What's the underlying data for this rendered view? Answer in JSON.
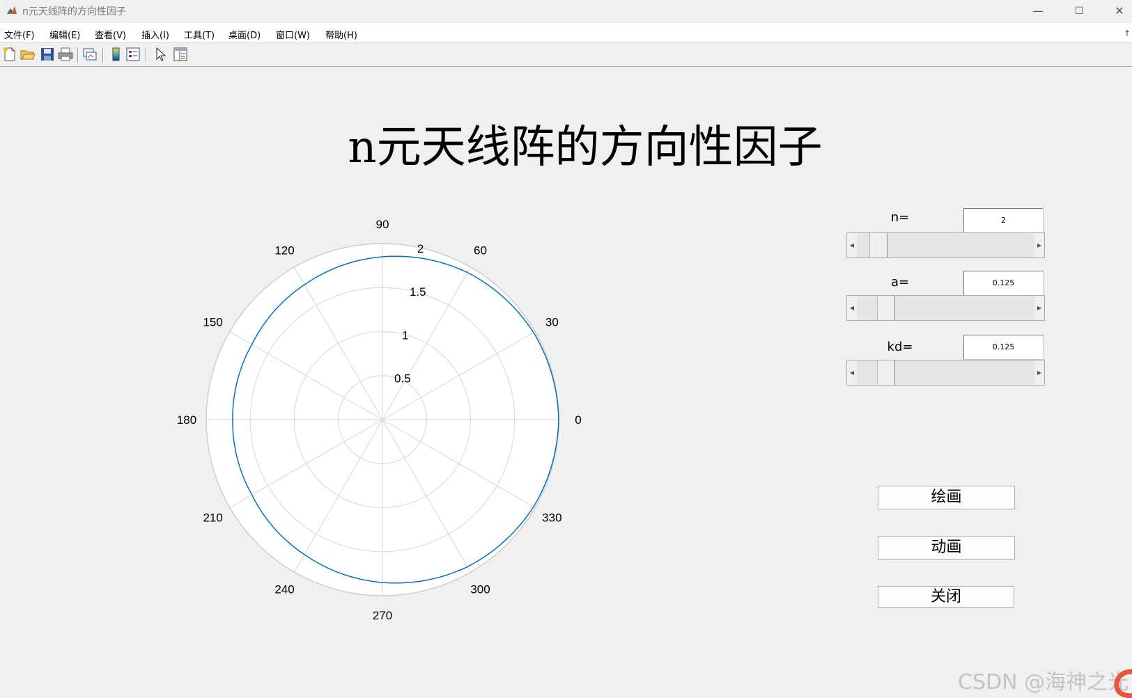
{
  "window": {
    "title": "n元天线阵的方向性因子",
    "controls": {
      "minimize": "—",
      "maximize": "☐",
      "close": "✕"
    }
  },
  "menu": {
    "items": [
      "文件(F)",
      "编辑(E)",
      "查看(V)",
      "插入(I)",
      "工具(T)",
      "桌面(D)",
      "窗口(W)",
      "帮助(H)"
    ],
    "collapse": "↑"
  },
  "toolbar": {
    "buttons": [
      "new-figure-icon",
      "open-file-icon",
      "save-icon",
      "print-icon",
      "link-plot-icon",
      "colorbar-icon",
      "legend-icon",
      "pointer-icon",
      "property-editor-icon"
    ]
  },
  "figure": {
    "title": "n元天线阵的方向性因子"
  },
  "chart_data": {
    "type": "polar",
    "theta_ticks": [
      "0",
      "30",
      "60",
      "90",
      "120",
      "150",
      "180",
      "210",
      "240",
      "270",
      "300",
      "330"
    ],
    "r_ticks": [
      "0.5",
      "1",
      "1.5",
      "2"
    ],
    "rlim": [
      0,
      2
    ],
    "grid": true,
    "series": [
      {
        "theta_deg": [
          0,
          30,
          60,
          90,
          120,
          150,
          180,
          210,
          240,
          270,
          300,
          330,
          360
        ],
        "r": [
          2.0,
          1.98,
          1.93,
          1.85,
          1.77,
          1.71,
          1.7,
          1.71,
          1.77,
          1.85,
          1.93,
          1.98,
          2.0
        ],
        "color": "#0072bd"
      }
    ]
  },
  "controls": {
    "n": {
      "label": "n=",
      "value": "2",
      "slider_fraction": 0.08
    },
    "a": {
      "label": "a=",
      "value": "0.125",
      "slider_fraction": 0.125
    },
    "kd": {
      "label": "kd=",
      "value": "0.125",
      "slider_fraction": 0.125
    }
  },
  "buttons": {
    "draw": "绘画",
    "animate": "动画",
    "close": "关闭"
  },
  "watermark": "CSDN @海神之光"
}
